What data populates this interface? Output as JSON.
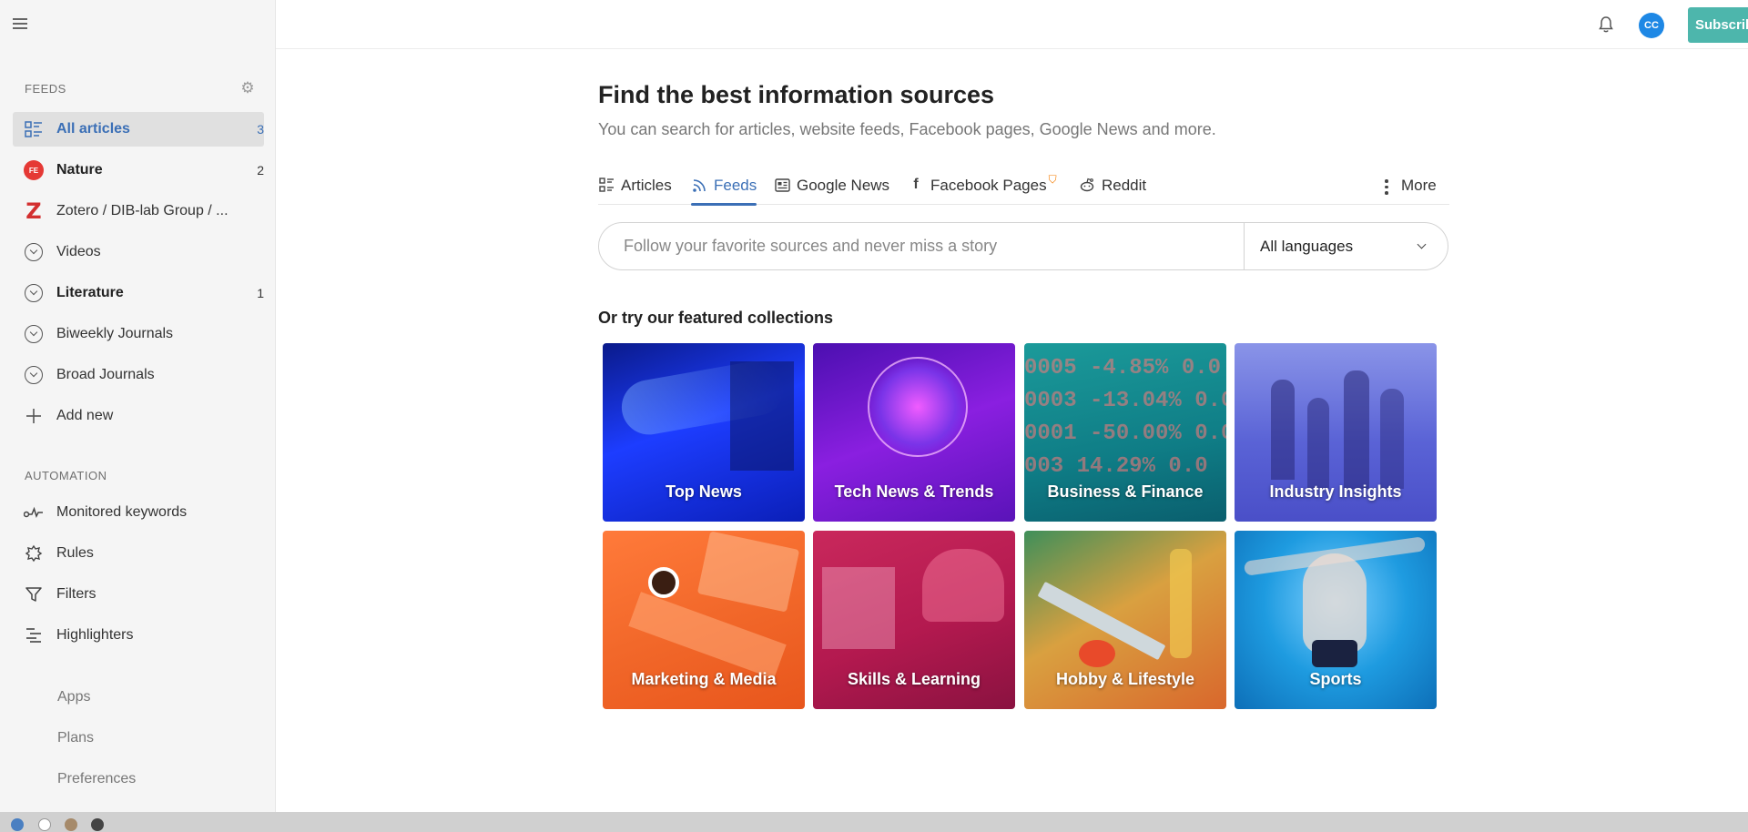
{
  "sidebar": {
    "feeds_title": "FEEDS",
    "automation_title": "AUTOMATION",
    "items": [
      {
        "label": "All articles",
        "count": "3"
      },
      {
        "label": "Nature",
        "count": "2",
        "badge": "FE"
      },
      {
        "label": "Zotero / DIB-lab Group / ...",
        "count": "",
        "logo": "Z"
      },
      {
        "label": "Videos",
        "count": ""
      },
      {
        "label": "Literature",
        "count": "1"
      },
      {
        "label": "Biweekly Journals",
        "count": ""
      },
      {
        "label": "Broad Journals",
        "count": ""
      },
      {
        "label": "Add new",
        "count": ""
      }
    ],
    "automation": [
      {
        "label": "Monitored keywords",
        "icon": "keywords-icon"
      },
      {
        "label": "Rules",
        "icon": "rules-icon"
      },
      {
        "label": "Filters",
        "icon": "filter-icon"
      },
      {
        "label": "Highlighters",
        "icon": "highlighter-icon"
      }
    ],
    "footer": [
      "Apps",
      "Plans",
      "Preferences"
    ]
  },
  "topbar": {
    "avatar_initials": "CC",
    "subscribe_label": "Subscribe"
  },
  "main": {
    "title": "Find the best information sources",
    "subtitle": "You can search for articles, website feeds, Facebook pages, Google News and more.",
    "tabs": [
      {
        "label": "Articles",
        "icon": "articles-icon"
      },
      {
        "label": "Feeds",
        "icon": "rss-icon"
      },
      {
        "label": "Google News",
        "icon": "news-icon"
      },
      {
        "label": "Facebook Pages",
        "icon": "facebook-icon"
      },
      {
        "label": "Reddit",
        "icon": "reddit-icon"
      },
      {
        "label": "More",
        "icon": "more-icon"
      }
    ],
    "active_tab": "Feeds",
    "search": {
      "placeholder": "Follow your favorite sources and never miss a story",
      "language": "All languages"
    },
    "featured_title": "Or try our featured collections",
    "collections": [
      {
        "label": "Top News",
        "color": "#1a2fd6"
      },
      {
        "label": "Tech News & Trends",
        "color": "#7a1fd6"
      },
      {
        "label": "Business & Finance",
        "color": "#0f8f94"
      },
      {
        "label": "Industry Insights",
        "color": "#5a5fd8"
      },
      {
        "label": "Marketing & Media",
        "color": "#f2682a"
      },
      {
        "label": "Skills & Learning",
        "color": "#b3194f"
      },
      {
        "label": "Hobby & Lifestyle",
        "color": "#d9672c"
      },
      {
        "label": "Sports",
        "color": "#1e9be0"
      }
    ]
  },
  "colors": {
    "accent": "#3b6fb6",
    "subscribe": "#4db6ac",
    "avatar": "#1e88e5",
    "nature_badge": "#e53935"
  }
}
